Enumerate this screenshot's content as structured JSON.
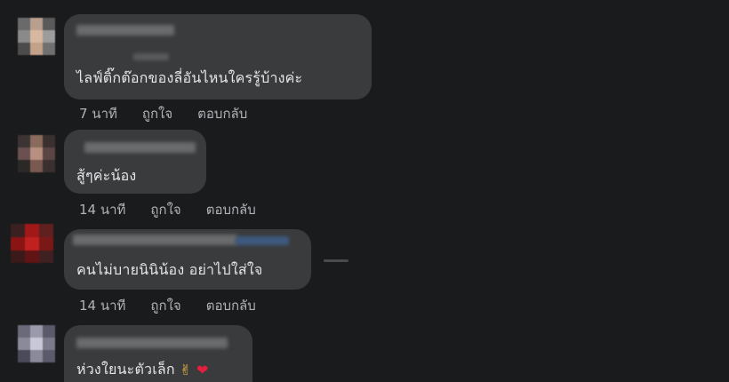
{
  "comments": [
    {
      "text": "ไลฟ์ติ๊กต๊อกของลี่อันไหนใครรู้บ้างค่ะ",
      "time": "7 นาที",
      "like": "ถูกใจ",
      "reply": "ตอบกลับ"
    },
    {
      "text": "สู้ๆค่ะน้อง",
      "time": "14 นาที",
      "like": "ถูกใจ",
      "reply": "ตอบกลับ"
    },
    {
      "text": "คนไม่บายนินิน้อง อย่าไปใส่ใจ",
      "time": "14 นาที",
      "like": "ถูกใจ",
      "reply": "ตอบกลับ"
    },
    {
      "text": "ห่วงใยนะตัวเล็ก",
      "emoji_1": "✌",
      "emoji_2": "❤",
      "emoji_2_color": "#e41e3f"
    }
  ],
  "colors": {
    "background": "#1a1b1c",
    "bubble": "#3a3b3c",
    "text": "#e4e6eb",
    "meta": "#b0b3b8"
  }
}
